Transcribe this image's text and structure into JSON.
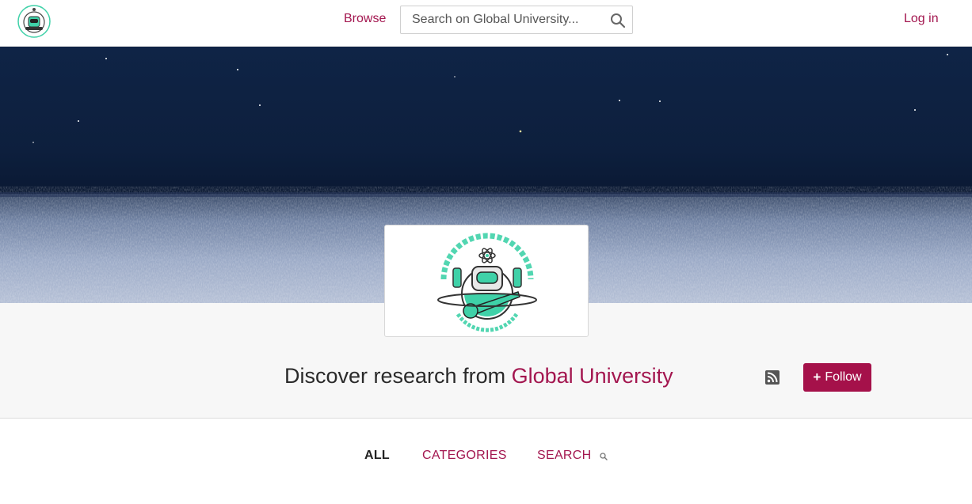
{
  "header": {
    "browse_label": "Browse",
    "search_placeholder": "Search on Global University...",
    "login_label": "Log in",
    "logo_icon": "global-university-logo-icon",
    "search_icon": "search-icon"
  },
  "profile": {
    "discover_prefix": "Discover research from ",
    "org_name": "Global University",
    "rss_icon": "rss-icon",
    "follow_label": "Follow",
    "follow_plus": "+"
  },
  "tabs": [
    {
      "label": "ALL",
      "active": true
    },
    {
      "label": "CATEGORIES",
      "active": false
    },
    {
      "label": "SEARCH",
      "active": false
    }
  ],
  "colors": {
    "accent": "#a3164f",
    "follow_bg": "#a5114a",
    "logo_teal": "#3fd1a8"
  }
}
